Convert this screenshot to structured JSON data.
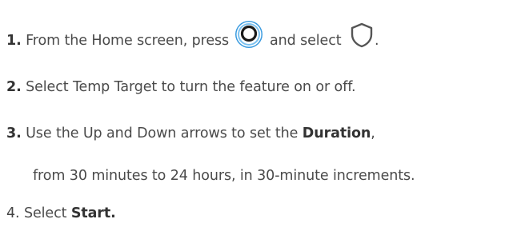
{
  "steps": [
    {
      "number": "1.",
      "text_before": "From the Home screen, press",
      "icon_1": "menu-button-icon",
      "text_middle": " and select",
      "icon_2": "shield-icon",
      "text_after": "."
    },
    {
      "number": "2.",
      "text": "Select Temp Target to turn the feature on or off."
    },
    {
      "number": "3.",
      "text_before": "Use the Up and Down arrows to set the ",
      "bold": "Duration",
      "text_after": ",",
      "continuation": "from 30 minutes to 24 hours, in 30-minute increments."
    },
    {
      "number": "4.",
      "text_before": "Select ",
      "bold": "Start."
    }
  ],
  "colors": {
    "text": "#4a4a4a",
    "button_ring": "#2b8fd6",
    "shield_stroke": "#555555"
  }
}
